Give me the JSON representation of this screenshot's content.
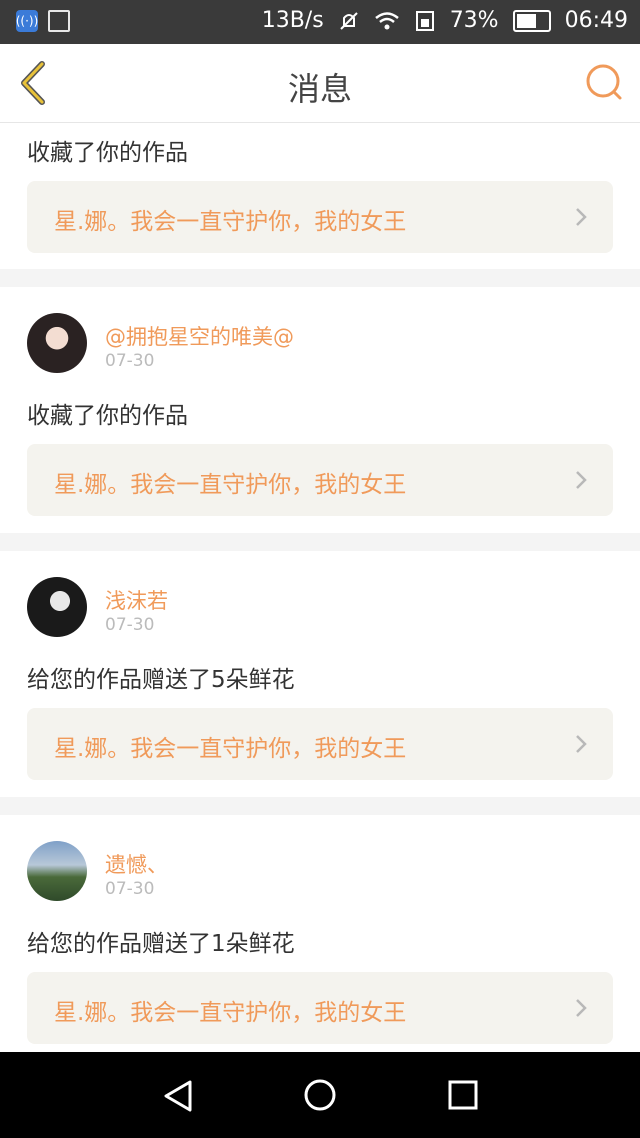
{
  "status_bar": {
    "speed": "13B/s",
    "battery": "73%",
    "battery_level": 0.73,
    "time": "06:49"
  },
  "header": {
    "title": "消息"
  },
  "colors": {
    "accent": "#f09a5a",
    "back_arrow": "#e8c23a",
    "work_bg": "#f4f3ee"
  },
  "items": [
    {
      "action": "收藏了你的作品",
      "work_title": "星.娜。我会一直守护你，我的女王"
    },
    {
      "user": "@拥抱星空的唯美@",
      "date": "07-30",
      "action": "收藏了你的作品",
      "work_title": "星.娜。我会一直守护你，我的女王"
    },
    {
      "user": "浅沫若",
      "date": "07-30",
      "action": "给您的作品赠送了5朵鲜花",
      "work_title": "星.娜。我会一直守护你，我的女王"
    },
    {
      "user": "遗憾、",
      "date": "07-30",
      "action": "给您的作品赠送了1朵鲜花",
      "work_title": "星.娜。我会一直守护你，我的女王"
    }
  ]
}
